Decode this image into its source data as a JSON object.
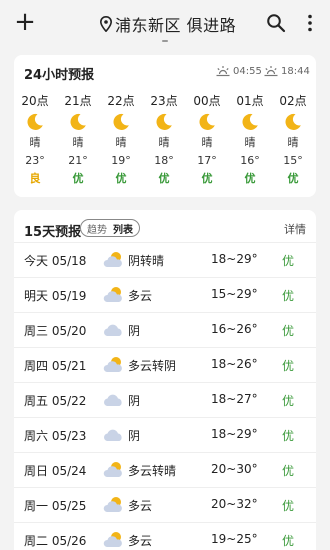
{
  "header": {
    "add_icon": "plus-icon",
    "location_icon": "location-pin-icon",
    "city": "浦东新区 俱进路",
    "search_icon": "search-icon",
    "more_icon": "more-vertical-icon"
  },
  "hourly": {
    "title": "24小时预报",
    "sunrise": "04:55",
    "sunset": "18:44",
    "hours": [
      {
        "time": "20点",
        "icon": "crescent-moon-icon",
        "cond": "晴",
        "temp": "23°",
        "aqi": "良",
        "aqi_color": "#e6a700"
      },
      {
        "time": "21点",
        "icon": "crescent-moon-icon",
        "cond": "晴",
        "temp": "21°",
        "aqi": "优",
        "aqi_color": "#3a9a3a"
      },
      {
        "time": "22点",
        "icon": "crescent-moon-icon",
        "cond": "晴",
        "temp": "19°",
        "aqi": "优",
        "aqi_color": "#3a9a3a"
      },
      {
        "time": "23点",
        "icon": "crescent-moon-icon",
        "cond": "晴",
        "temp": "18°",
        "aqi": "优",
        "aqi_color": "#3a9a3a"
      },
      {
        "time": "00点",
        "icon": "crescent-moon-icon",
        "cond": "晴",
        "temp": "17°",
        "aqi": "优",
        "aqi_color": "#3a9a3a"
      },
      {
        "time": "01点",
        "icon": "crescent-moon-icon",
        "cond": "晴",
        "temp": "16°",
        "aqi": "优",
        "aqi_color": "#3a9a3a"
      },
      {
        "time": "02点",
        "icon": "crescent-moon-icon",
        "cond": "晴",
        "temp": "15°",
        "aqi": "优",
        "aqi_color": "#3a9a3a"
      }
    ]
  },
  "daily": {
    "title": "15天预报",
    "toggle": {
      "trend": "趋势",
      "list": "列表"
    },
    "detail": "详情",
    "days": [
      {
        "day": "今天 05/18",
        "icon": "cloud-sun-icon",
        "cond": "阴转晴",
        "range": "18~29°",
        "aqi": "优"
      },
      {
        "day": "明天 05/19",
        "icon": "cloud-sun-icon",
        "cond": "多云",
        "range": "15~29°",
        "aqi": "优"
      },
      {
        "day": "周三 05/20",
        "icon": "cloud-icon",
        "cond": "阴",
        "range": "16~26°",
        "aqi": "优"
      },
      {
        "day": "周四 05/21",
        "icon": "cloud-sun-icon",
        "cond": "多云转阴",
        "range": "18~26°",
        "aqi": "优"
      },
      {
        "day": "周五 05/22",
        "icon": "cloud-icon",
        "cond": "阴",
        "range": "18~27°",
        "aqi": "优"
      },
      {
        "day": "周六 05/23",
        "icon": "cloud-icon",
        "cond": "阴",
        "range": "18~29°",
        "aqi": "优"
      },
      {
        "day": "周日 05/24",
        "icon": "cloud-sun-icon",
        "cond": "多云转晴",
        "range": "20~30°",
        "aqi": "优"
      },
      {
        "day": "周一 05/25",
        "icon": "cloud-sun-icon",
        "cond": "多云",
        "range": "20~32°",
        "aqi": "优"
      },
      {
        "day": "周二 05/26",
        "icon": "cloud-sun-icon",
        "cond": "多云",
        "range": "19~25°",
        "aqi": "优"
      }
    ]
  },
  "colors": {
    "aqi_good": "#3a9a3a",
    "aqi_moderate": "#e6a700",
    "moon": "#f2b417",
    "cloud": "#c9d3e6",
    "sun": "#f2b417"
  }
}
